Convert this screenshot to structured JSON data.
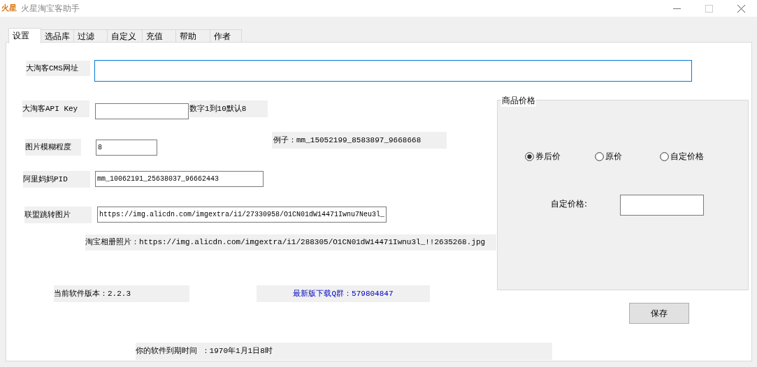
{
  "window": {
    "icon_text": "火星",
    "title": "火星淘宝客助手"
  },
  "tabs": [
    {
      "label": "设置",
      "selected": true
    },
    {
      "label": "选品库",
      "selected": false
    },
    {
      "label": "过滤",
      "selected": false
    },
    {
      "label": "自定义",
      "selected": false
    },
    {
      "label": "充值",
      "selected": false
    },
    {
      "label": "帮助",
      "selected": false
    },
    {
      "label": "作者",
      "selected": false
    }
  ],
  "fields": [
    {
      "label": "大淘客CMS网址",
      "focused": true
    },
    {
      "label": "大淘客API Key",
      "focused": false
    },
    {
      "label": "图片模糊程度",
      "value": "8",
      "focused": false
    },
    {
      "label": "阿里妈妈PID",
      "value": "mm_10062191_25638037_96662443",
      "focused": false
    },
    {
      "label": "联盟跳转图片",
      "value": "https://img.alicdn.com/imgextra/i1/27330958/O1CN01dW14471Iwnu7Neu3l_",
      "focused": false
    }
  ],
  "hints": [
    {
      "text": "数字1到10默认8"
    },
    {
      "text": "例子：mm_15052199_8583897_9668668"
    },
    {
      "text": "淘宝相册照片：https://img.alicdn.com/imgextra/i1/288305/O1CN01dW14471Iwnu3l_!!2635268.jpg"
    }
  ],
  "info": [
    {
      "text": "当前软件版本：2.2.3",
      "kind": "plain"
    },
    {
      "text": "最新版下载Q群：579804847",
      "kind": "link"
    },
    {
      "text": "你的软件到期时间 ：1970年1月1日8时",
      "kind": "plain"
    }
  ],
  "price_group": {
    "title": "商品价格",
    "options": [
      {
        "label": "券后价",
        "selected": true
      },
      {
        "label": "原价",
        "selected": false
      },
      {
        "label": "自定价格",
        "selected": false
      }
    ],
    "custom_label": "自定价格:"
  },
  "save_button": "保存"
}
